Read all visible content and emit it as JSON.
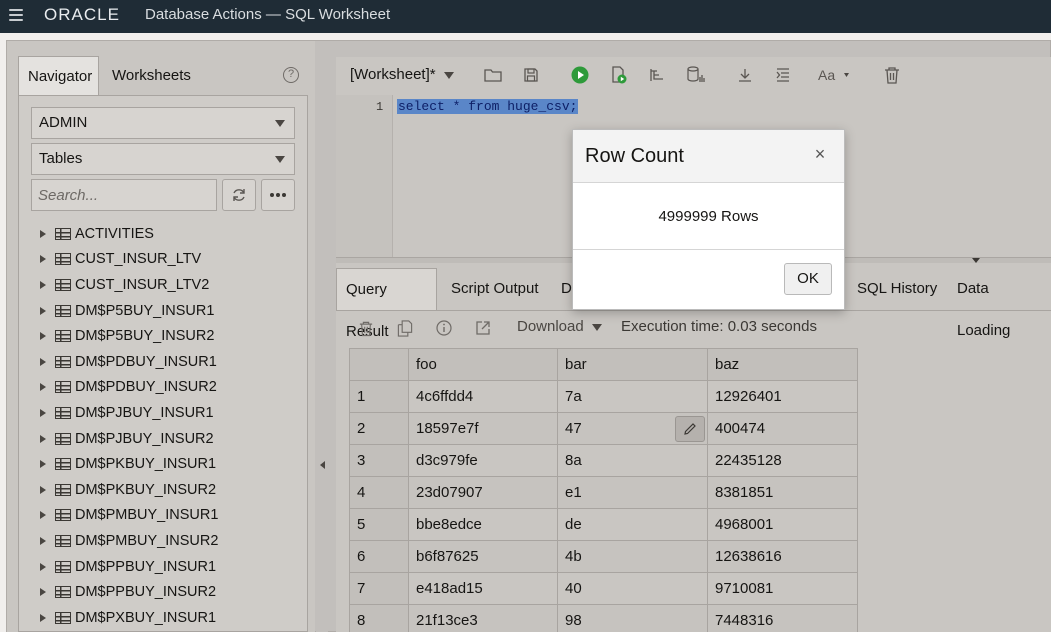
{
  "app": {
    "brand": "ORACLE",
    "title": "Database Actions — SQL Worksheet"
  },
  "navigator": {
    "tabs": [
      "Navigator",
      "Worksheets"
    ],
    "schema": "ADMIN",
    "object_type": "Tables",
    "search_placeholder": "Search...",
    "items": [
      "ACTIVITIES",
      "CUST_INSUR_LTV",
      "CUST_INSUR_LTV2",
      "DM$P5BUY_INSUR1",
      "DM$P5BUY_INSUR2",
      "DM$PDBUY_INSUR1",
      "DM$PDBUY_INSUR2",
      "DM$PJBUY_INSUR1",
      "DM$PJBUY_INSUR2",
      "DM$PKBUY_INSUR1",
      "DM$PKBUY_INSUR2",
      "DM$PMBUY_INSUR1",
      "DM$PMBUY_INSUR2",
      "DM$PPBUY_INSUR1",
      "DM$PPBUY_INSUR2",
      "DM$PXBUY_INSUR1"
    ]
  },
  "worksheet": {
    "name": "[Worksheet]*",
    "line_number": "1",
    "code": "select * from huge_csv;"
  },
  "results": {
    "tabs": [
      "Query Result",
      "Script Output",
      "D",
      "SQL History",
      "Data Loading"
    ],
    "download_label": "Download",
    "execution_time": "Execution time: 0.03 seconds",
    "columns": [
      "foo",
      "bar",
      "baz"
    ],
    "rows": [
      [
        "1",
        "4c6ffdd4",
        "7a",
        "12926401"
      ],
      [
        "2",
        "18597e7f",
        "47",
        "400474"
      ],
      [
        "3",
        "d3c979fe",
        "8a",
        "22435128"
      ],
      [
        "4",
        "23d07907",
        "e1",
        "8381851"
      ],
      [
        "5",
        "bbe8edce",
        "de",
        "4968001"
      ],
      [
        "6",
        "b6f87625",
        "4b",
        "12638616"
      ],
      [
        "7",
        "e418ad15",
        "40",
        "9710081"
      ],
      [
        "8",
        "21f13ce3",
        "98",
        "7448316"
      ]
    ]
  },
  "dialog": {
    "title": "Row Count",
    "message": "4999999 Rows",
    "ok_label": "OK",
    "close_symbol": "×"
  },
  "colors": {
    "topbar": "#1f2c36",
    "run_green": "#2e9a3a"
  }
}
